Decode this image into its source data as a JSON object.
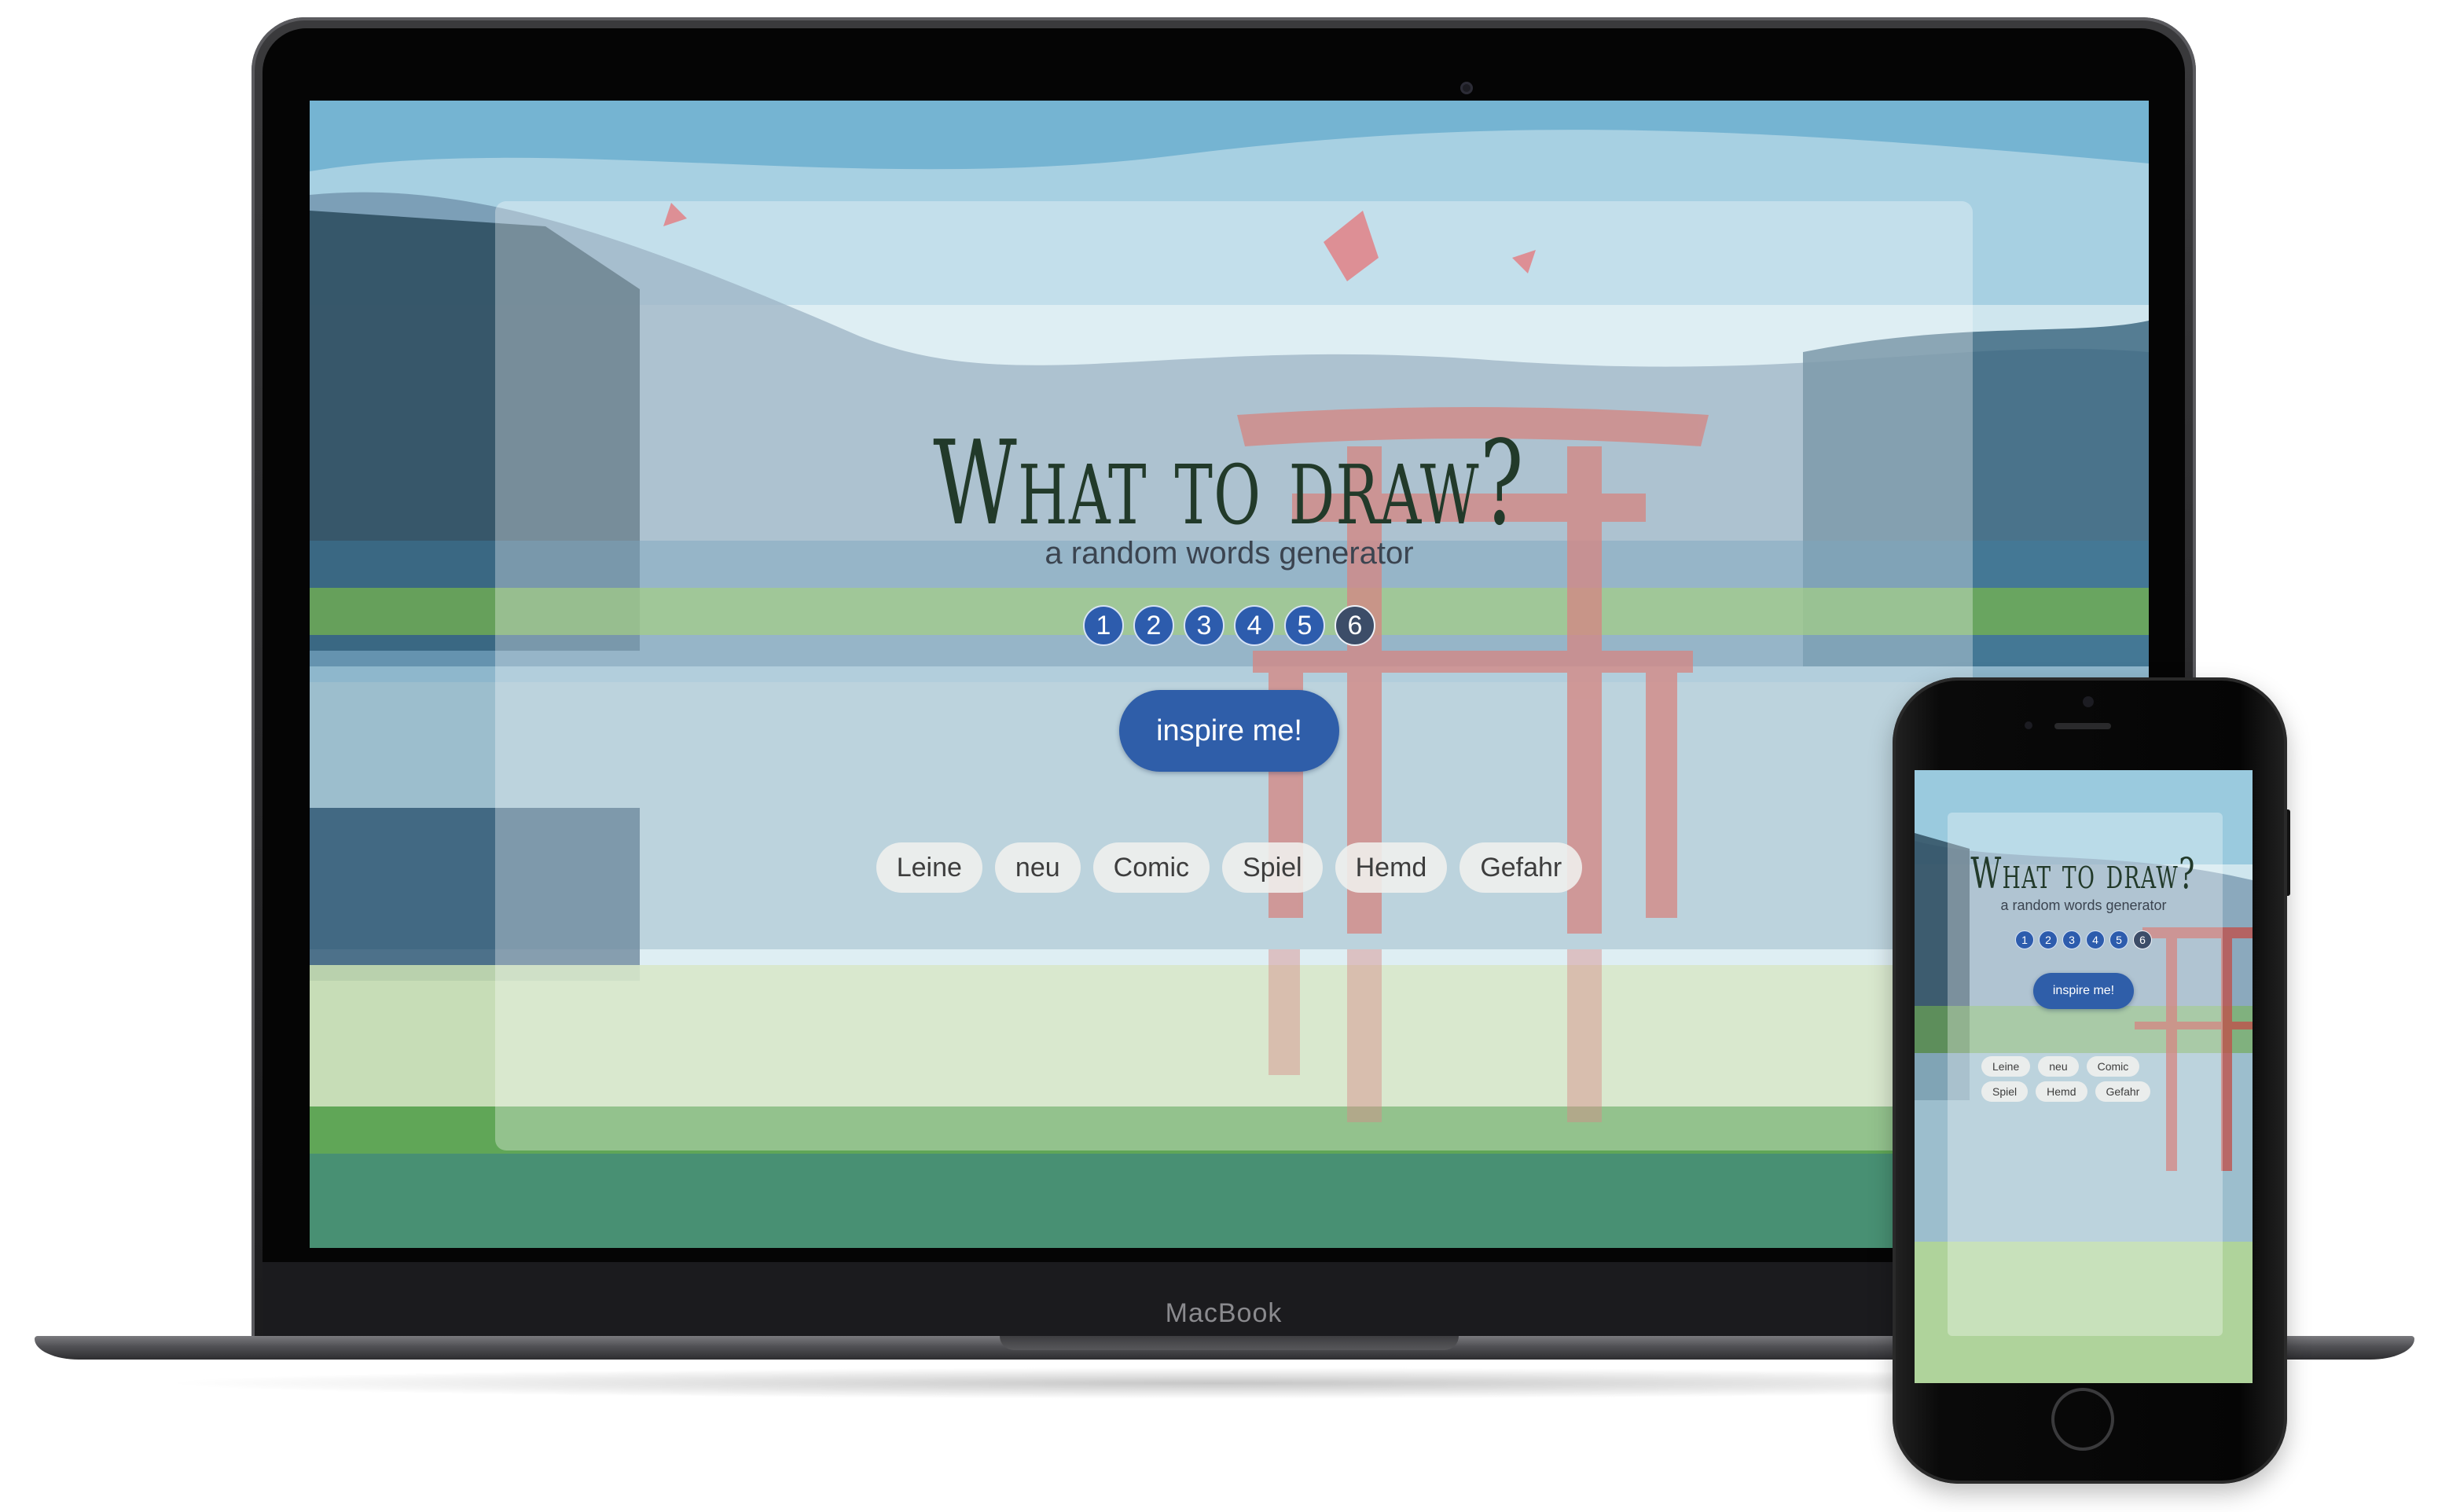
{
  "laptop": {
    "brand": "MacBook"
  },
  "app": {
    "title": "What to draw?",
    "subtitle": "a random words generator",
    "numbers": [
      "1",
      "2",
      "3",
      "4",
      "5",
      "6"
    ],
    "selected_number": "6",
    "inspire_label": "inspire me!",
    "words": [
      "Leine",
      "neu",
      "Comic",
      "Spiel",
      "Hemd",
      "Gefahr"
    ]
  },
  "colors": {
    "accent": "#2f5ea9",
    "selected": "#3c4d68",
    "title_ink": "#223a2a"
  }
}
